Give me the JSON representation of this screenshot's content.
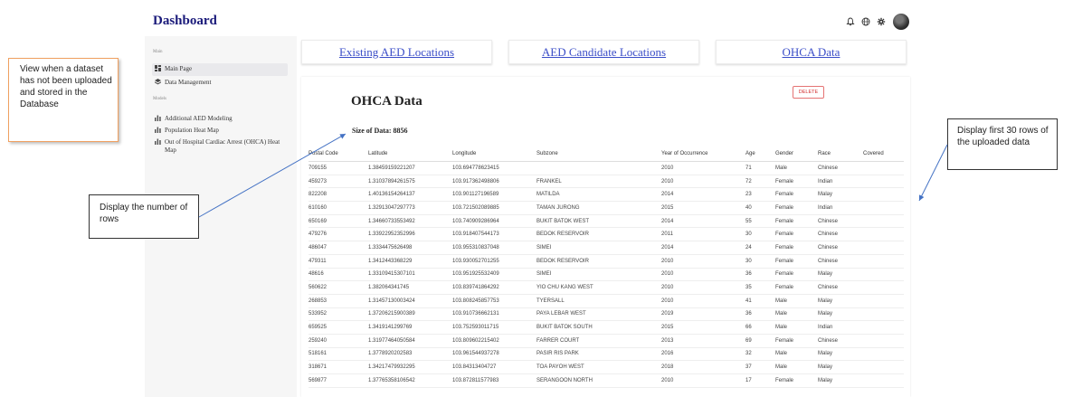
{
  "header": {
    "title": "Dashboard",
    "icons": [
      "bell-icon",
      "globe-icon",
      "gear-icon"
    ]
  },
  "sidebar": {
    "section_main": "Main",
    "section_models": "Models",
    "items": [
      {
        "label": "Main Page",
        "icon": "dashboard-icon",
        "active": true
      },
      {
        "label": "Data Management",
        "icon": "layers-icon",
        "active": false
      },
      {
        "label": "Additional AED Modeling",
        "icon": "bar-chart-icon",
        "active": false
      },
      {
        "label": "Population Heat Map",
        "icon": "bar-chart-icon",
        "active": false
      },
      {
        "label": "Out of Hospital Cardiac Arrest (OHCA) Heat Map",
        "icon": "bar-chart-icon",
        "active": false
      }
    ]
  },
  "tabs": [
    {
      "label": "Existing AED Locations"
    },
    {
      "label": "AED Candidate Locations"
    },
    {
      "label": "OHCA Data"
    }
  ],
  "main": {
    "title": "OHCA Data",
    "delete_label": "DELETE",
    "size_text": "Size of Data: 8856",
    "accent_color": "#3b4ec8",
    "delete_color": "#d32f2f"
  },
  "table": {
    "columns": [
      "Postal Code",
      "Latitude",
      "Longitude",
      "Subzone",
      "Year of Occurrence",
      "Age",
      "Gender",
      "Race",
      "Covered"
    ],
    "rows": [
      [
        "709155",
        "1.38459159221207",
        "103.694778623415",
        "",
        "2010",
        "71",
        "Male",
        "Chinese",
        ""
      ],
      [
        "459273",
        "1.31037894261575",
        "103.917362498806",
        "FRANKEL",
        "2010",
        "72",
        "Female",
        "Indian",
        ""
      ],
      [
        "822208",
        "1.40136154264137",
        "103.901127196589",
        "MATILDA",
        "2014",
        "23",
        "Female",
        "Malay",
        ""
      ],
      [
        "610160",
        "1.32913047297773",
        "103.721502089885",
        "TAMAN JURONG",
        "2015",
        "40",
        "Female",
        "Indian",
        ""
      ],
      [
        "650169",
        "1.34660733553492",
        "103.740909286964",
        "BUKIT BATOK WEST",
        "2014",
        "55",
        "Female",
        "Chinese",
        ""
      ],
      [
        "479276",
        "1.33922952352996",
        "103.918407544173",
        "BEDOK RESERVOIR",
        "2011",
        "30",
        "Female",
        "Chinese",
        ""
      ],
      [
        "486047",
        "1.3334475626498",
        "103.955310837048",
        "SIMEI",
        "2014",
        "24",
        "Female",
        "Chinese",
        ""
      ],
      [
        "479311",
        "1.3412443368229",
        "103.930052701255",
        "BEDOK RESERVOIR",
        "2010",
        "30",
        "Female",
        "Chinese",
        ""
      ],
      [
        "48616",
        "1.33109415307101",
        "103.951925532409",
        "SIMEI",
        "2010",
        "36",
        "Female",
        "Malay",
        ""
      ],
      [
        "560622",
        "1.382064341745",
        "103.839741864292",
        "YIO CHU KANG WEST",
        "2010",
        "35",
        "Female",
        "Chinese",
        ""
      ],
      [
        "268853",
        "1.31457130003424",
        "103.808245857753",
        "TYERSALL",
        "2010",
        "41",
        "Male",
        "Malay",
        ""
      ],
      [
        "533952",
        "1.37206215900389",
        "103.910736662131",
        "PAYA LEBAR WEST",
        "2019",
        "36",
        "Male",
        "Malay",
        ""
      ],
      [
        "659525",
        "1.3419141299769",
        "103.752593011715",
        "BUKIT BATOK SOUTH",
        "2015",
        "66",
        "Male",
        "Indian",
        ""
      ],
      [
        "259240",
        "1.31977464050584",
        "103.809602215402",
        "FARRER COURT",
        "2013",
        "69",
        "Female",
        "Chinese",
        ""
      ],
      [
        "518161",
        "1.3778920202583",
        "103.961544937278",
        "PASIR RIS PARK",
        "2016",
        "32",
        "Male",
        "Malay",
        ""
      ],
      [
        "318671",
        "1.34217479932295",
        "103.84313404727",
        "TOA PAYOH WEST",
        "2018",
        "37",
        "Male",
        "Malay",
        ""
      ],
      [
        "569877",
        "1.37765358106542",
        "103.872811577983",
        "SERANGOON NORTH",
        "2010",
        "17",
        "Female",
        "Malay",
        ""
      ]
    ]
  },
  "annotations": {
    "left_note": "View when a dataset has not been uploaded and stored in the Database",
    "rows_note": "Display the number of rows",
    "right_note": "Display first 30 rows of the uploaded data"
  }
}
